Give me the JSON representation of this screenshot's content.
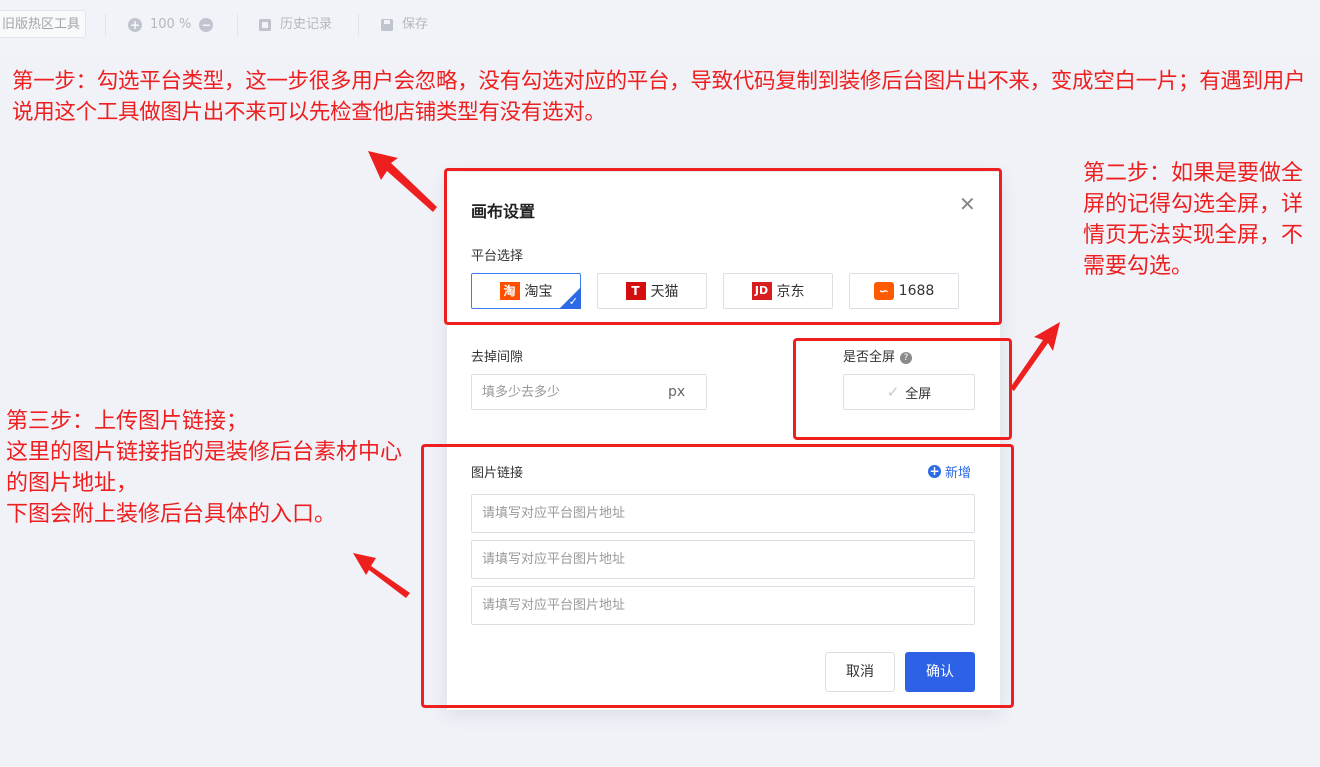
{
  "toolbar": {
    "old_tool": "旧版热区工具",
    "zoom": "100 %",
    "history": "历史记录",
    "save": "保存"
  },
  "annotations": {
    "step1": "第一步：勾选平台类型，这一步很多用户会忽略，没有勾选对应的平台，导致代码复制到装修后台图片出不来，变成空白一片；有遇到用户说用这个工具做图片出不来可以先检查他店铺类型有没有选对。",
    "step2": "第二步：如果是要做全屏的记得勾选全屏，详情页无法实现全屏，不需要勾选。",
    "step3": "第三步：上传图片链接；\n这里的图片链接指的是装修后台素材中心的图片地址，\n下图会附上装修后台具体的入口。"
  },
  "dialog": {
    "title": "画布设置",
    "platform_label": "平台选择",
    "platforms": [
      {
        "name": "淘宝",
        "logo": "淘",
        "color": "#ff5000",
        "selected": true
      },
      {
        "name": "天猫",
        "logo": "T",
        "color": "#d40e0e",
        "selected": false
      },
      {
        "name": "京东",
        "logo": "JD",
        "color": "#d81e1e",
        "selected": false
      },
      {
        "name": "1688",
        "logo": "∽",
        "color": "#ff5a00",
        "selected": false
      }
    ],
    "gap_label": "去掉间隙",
    "gap_placeholder": "填多少去多少",
    "gap_unit": "px",
    "fullscreen_label": "是否全屏",
    "fullscreen_help": "?",
    "fullscreen_button": "全屏",
    "fullscreen_checked": false,
    "image_link_label": "图片链接",
    "add_label": "新增",
    "image_link_placeholder": "请填写对应平台图片地址",
    "image_link_values": [
      "",
      "",
      ""
    ],
    "cancel": "取消",
    "confirm": "确认"
  },
  "colors": {
    "accent": "#2d62e6",
    "annotation": "#ee1f1f",
    "taobao_selected_border": "#3d7cf2"
  }
}
